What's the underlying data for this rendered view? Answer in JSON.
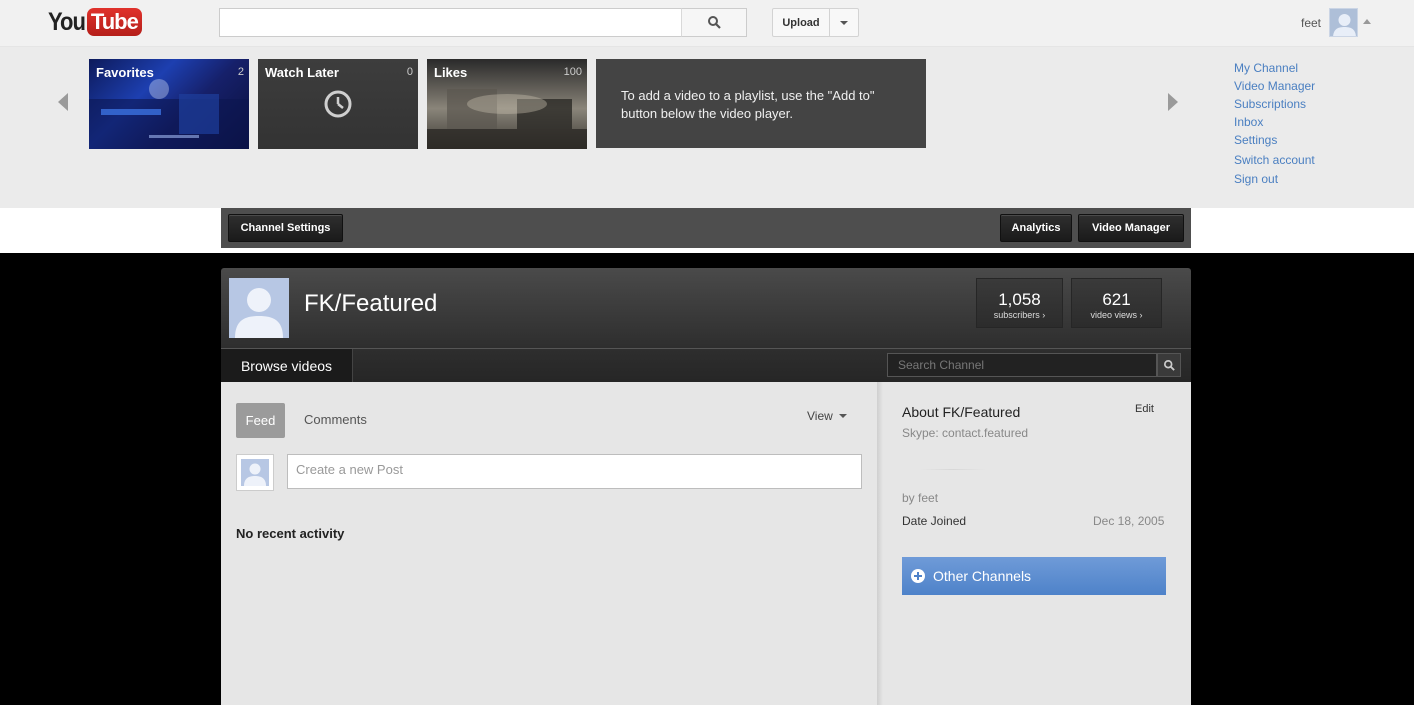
{
  "masthead": {
    "logo_you": "You",
    "logo_tube": "Tube",
    "search_value": "",
    "upload_label": "Upload",
    "username": "feet"
  },
  "guide": {
    "playlists": [
      {
        "title": "Favorites",
        "count": "2"
      },
      {
        "title": "Watch Later",
        "count": "0"
      },
      {
        "title": "Likes",
        "count": "100"
      }
    ],
    "hint": "To add a video to a playlist, use the \"Add to\" button below the video player.",
    "links": [
      "My Channel",
      "Video Manager",
      "Subscriptions",
      "Inbox",
      "Settings",
      "Switch account",
      "Sign out"
    ]
  },
  "owner_bar": {
    "channel_settings": "Channel Settings",
    "analytics": "Analytics",
    "video_manager": "Video Manager"
  },
  "channel": {
    "name": "FK/Featured",
    "subscribers_count": "1,058",
    "subscribers_label": "subscribers ›",
    "views_count": "621",
    "views_label": "video views ›",
    "browse_tab": "Browse videos",
    "search_placeholder": "Search Channel",
    "feed_tab": "Feed",
    "comments_tab": "Comments",
    "view_menu": "View",
    "post_placeholder": "Create a new Post",
    "no_activity": "No recent activity",
    "about_title": "About FK/Featured",
    "edit": "Edit",
    "about_text": "Skype: contact.featured",
    "by_line": "by feet",
    "date_joined_label": "Date Joined",
    "date_joined_value": "Dec 18, 2005",
    "other_channels": "Other Channels"
  },
  "colors": {
    "brand_red": "#c4302b",
    "link_blue": "#4a7fc1",
    "accent_blue": "#5a8ccf",
    "page_background": "#000000"
  }
}
